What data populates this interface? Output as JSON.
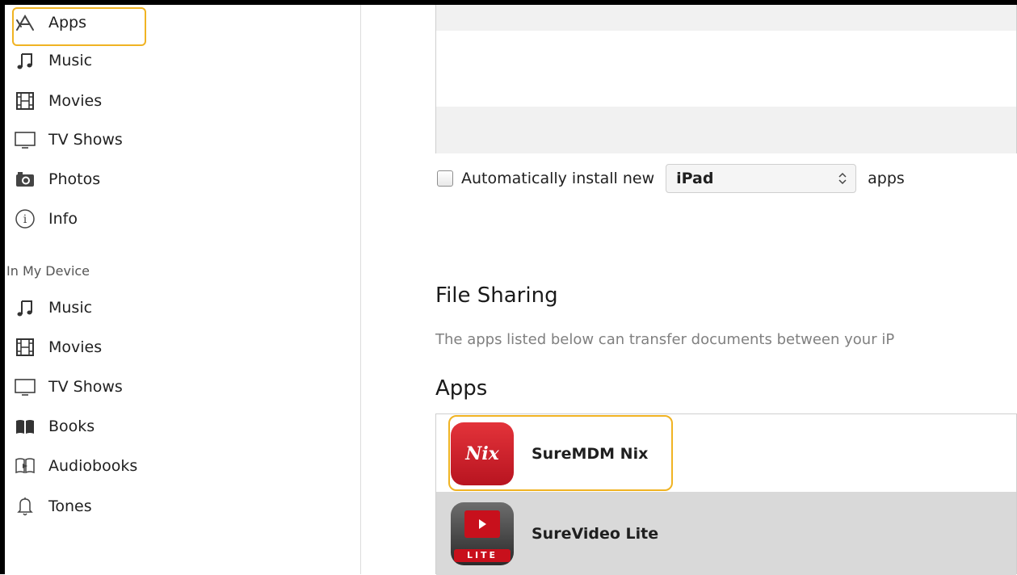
{
  "sidebar": {
    "settings_items": [
      {
        "label": "Apps",
        "icon": "app-store-icon"
      },
      {
        "label": "Music",
        "icon": "music-note-icon"
      },
      {
        "label": "Movies",
        "icon": "film-icon"
      },
      {
        "label": "TV Shows",
        "icon": "tv-icon"
      },
      {
        "label": "Photos",
        "icon": "camera-icon"
      },
      {
        "label": "Info",
        "icon": "info-icon"
      }
    ],
    "section_title": "In My Device",
    "device_items": [
      {
        "label": "Music",
        "icon": "music-note-icon"
      },
      {
        "label": "Movies",
        "icon": "film-icon"
      },
      {
        "label": "TV Shows",
        "icon": "tv-icon"
      },
      {
        "label": "Books",
        "icon": "book-icon"
      },
      {
        "label": "Audiobooks",
        "icon": "audiobook-icon"
      },
      {
        "label": "Tones",
        "icon": "bell-icon"
      }
    ]
  },
  "auto_install": {
    "prefix": "Automatically install new",
    "device_select": "iPad",
    "suffix": "apps",
    "checked": false
  },
  "file_sharing": {
    "title": "File Sharing",
    "description": "The apps listed below can transfer documents between your iP",
    "apps_title": "Apps",
    "apps": [
      {
        "name": "SureMDM Nix",
        "icon_text": "Nix",
        "icon": "suremdm-nix-icon"
      },
      {
        "name": "SureVideo Lite",
        "icon_text": "LITE",
        "icon": "surevideo-lite-icon"
      }
    ]
  },
  "colors": {
    "highlight": "#f0b323",
    "selected_row": "#d9d9d9",
    "nix_red": "#d0202a"
  }
}
